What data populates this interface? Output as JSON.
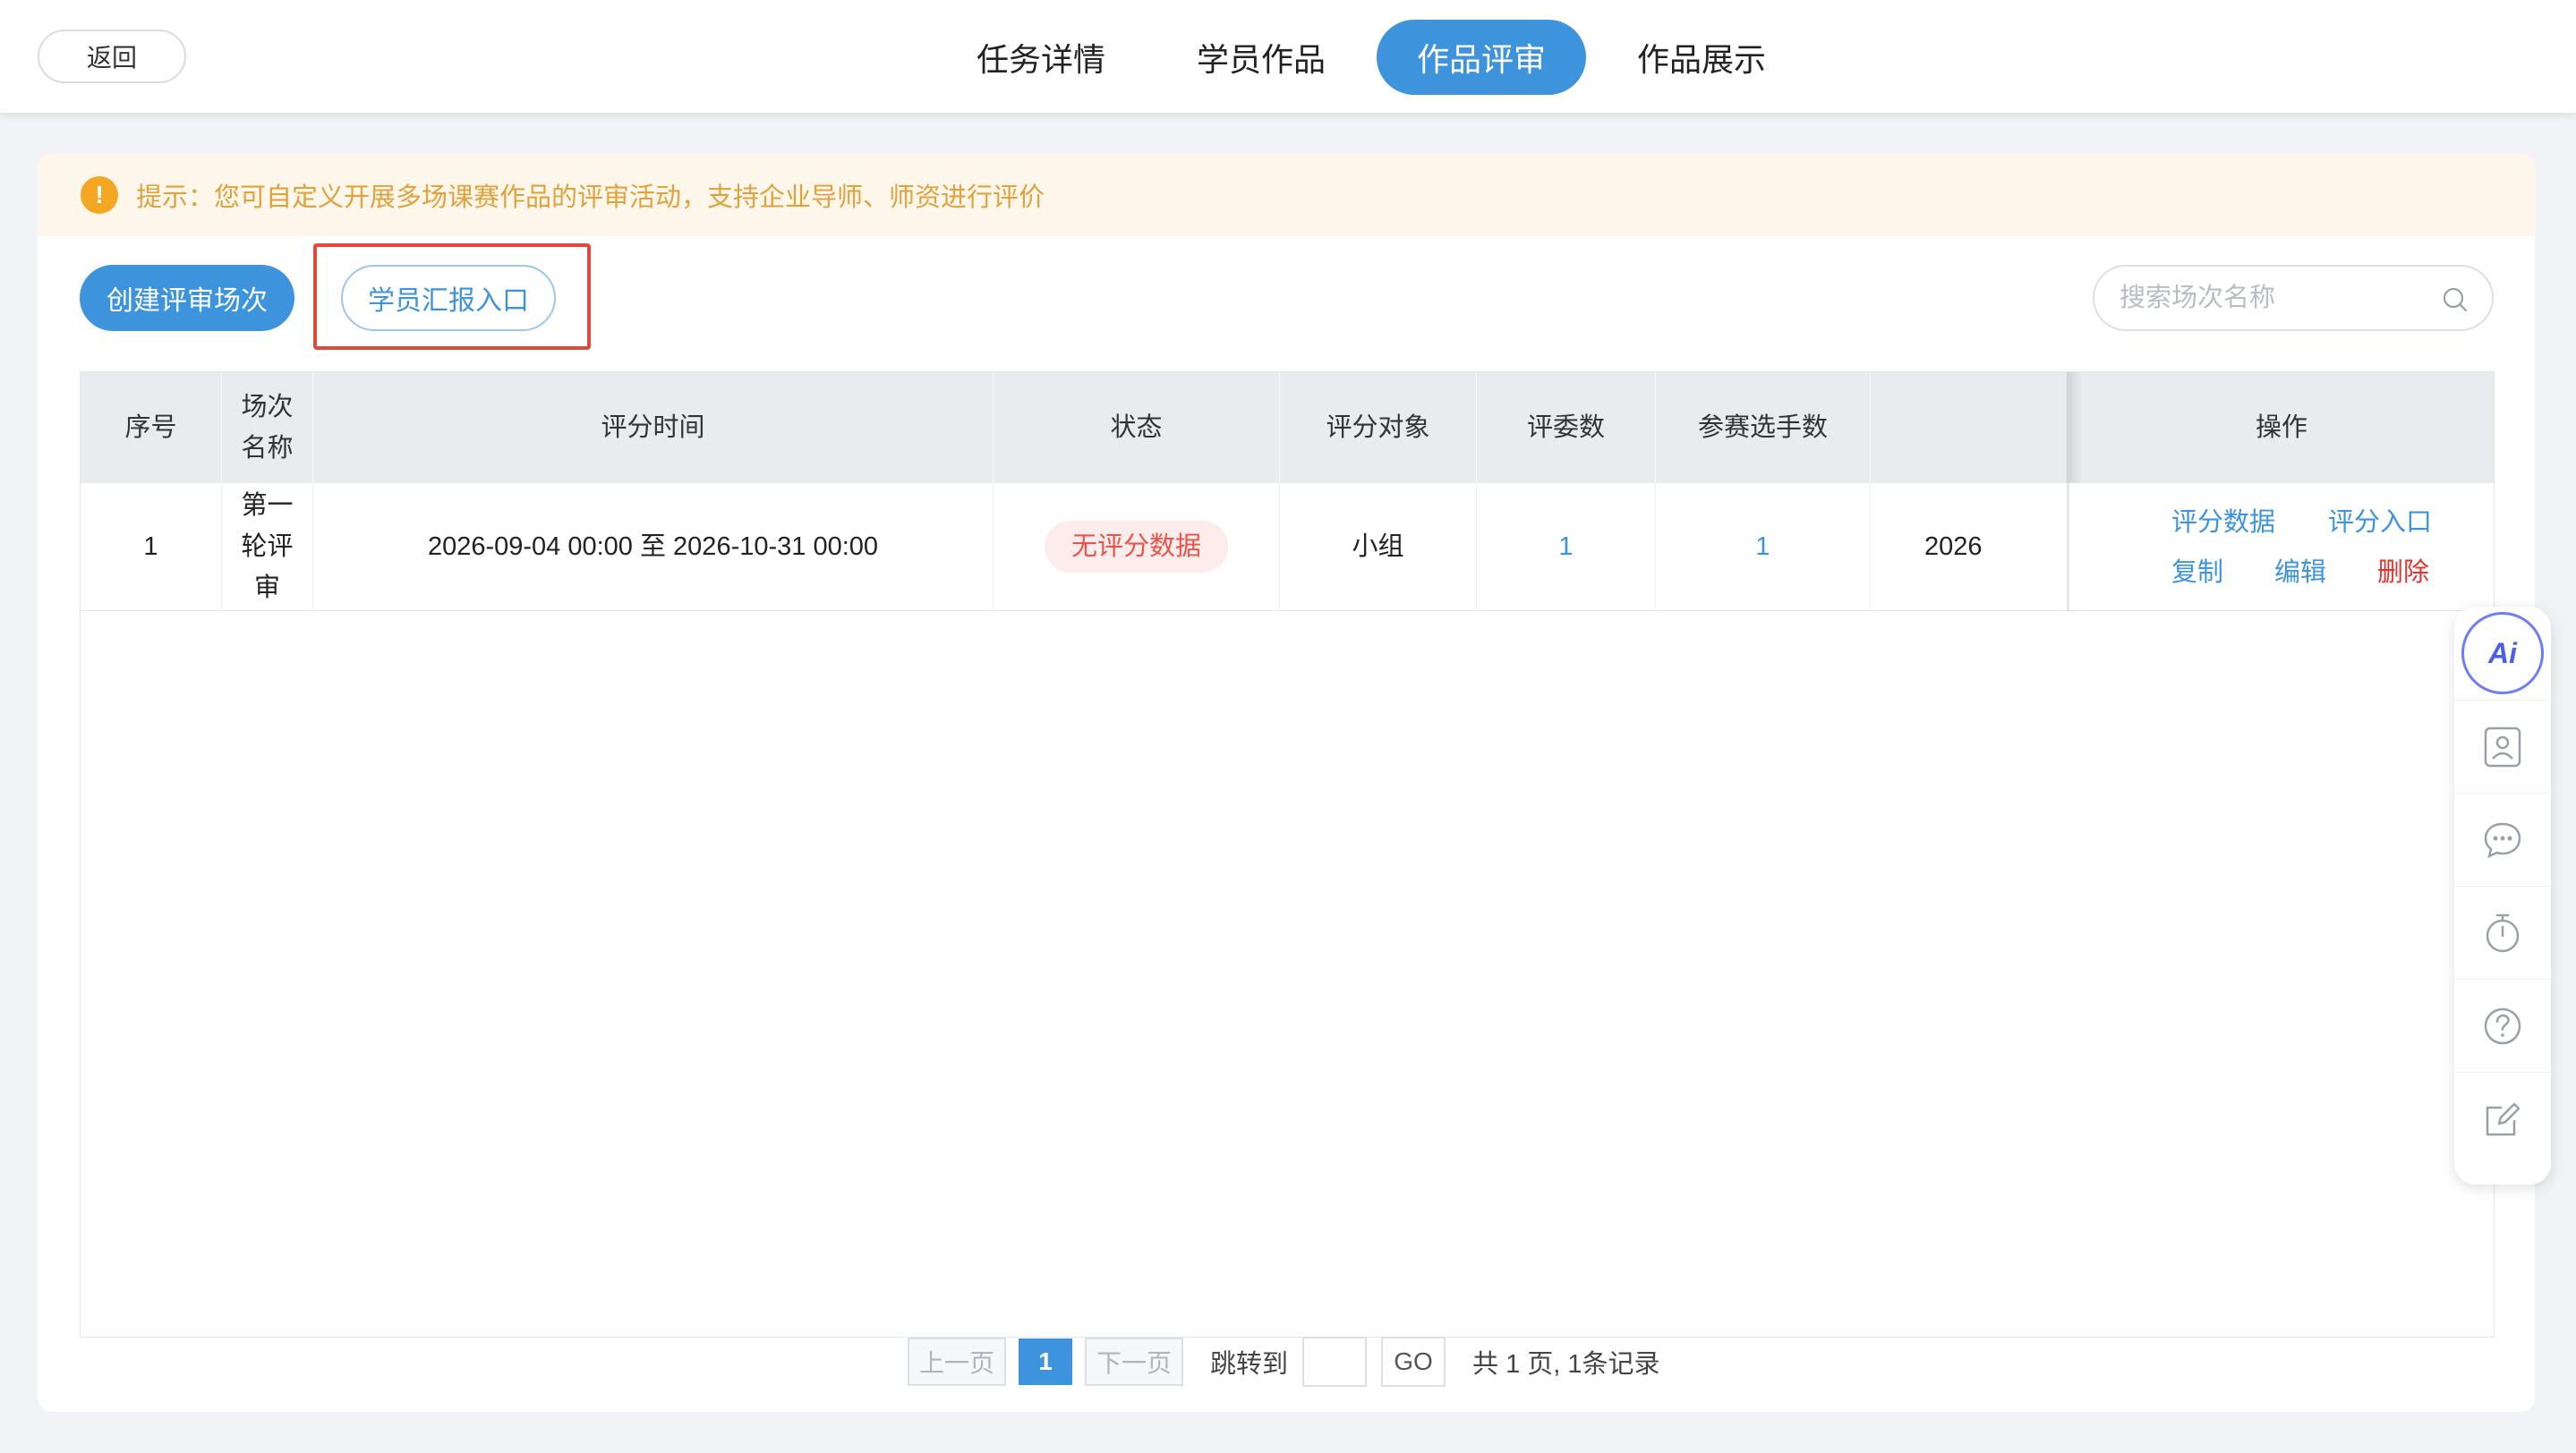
{
  "header": {
    "back_label": "返回",
    "tabs": [
      {
        "label": "任务详情",
        "active": false
      },
      {
        "label": "学员作品",
        "active": false
      },
      {
        "label": "作品评审",
        "active": true
      },
      {
        "label": "作品展示",
        "active": false
      }
    ]
  },
  "notice": {
    "icon": "!",
    "text": "提示：您可自定义开展多场课赛作品的评审活动，支持企业导师、师资进行评价"
  },
  "toolbar": {
    "create_label": "创建评审场次",
    "report_label": "学员汇报入口",
    "search_placeholder": "搜索场次名称"
  },
  "table": {
    "headers": {
      "index": "序号",
      "name": "场次名称",
      "time": "评分时间",
      "status": "状态",
      "target": "评分对象",
      "judges": "评委数",
      "players": "参赛选手数",
      "ops": "操作"
    },
    "rows": [
      {
        "index": "1",
        "name": "第一轮评审",
        "time": "2026-09-04 00:00 至 2026-10-31 00:00",
        "status": "无评分数据",
        "target": "小组",
        "judges": "1",
        "players": "1",
        "extra": "2026",
        "ops": {
          "score_data": "评分数据",
          "score_entry": "评分入口",
          "copy": "复制",
          "edit": "编辑",
          "delete": "删除"
        }
      }
    ]
  },
  "pagination": {
    "prev": "上一页",
    "current": "1",
    "next": "下一页",
    "jump_label": "跳转到",
    "go": "GO",
    "total": "共 1 页, 1条记录"
  },
  "sidebar": {
    "ai_label": "Ai",
    "icons": [
      "ai-icon",
      "contact-card-icon",
      "chat-bubble-icon",
      "timer-icon",
      "help-icon",
      "edit-icon"
    ]
  },
  "colors": {
    "primary": "#3d93dc",
    "warning_bg": "#fdf6eb",
    "warning_text": "#e0a23c",
    "danger": "#e5322d",
    "highlight_border": "#e04a3d"
  }
}
